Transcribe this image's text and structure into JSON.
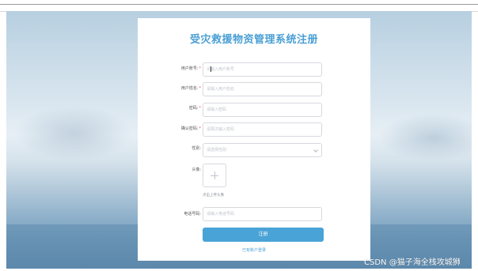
{
  "form": {
    "title": "受灾救援物资管理系统注册",
    "fields": [
      {
        "label": "用户账号:",
        "required": true,
        "placeholder": "请输入用户账号",
        "value": ""
      },
      {
        "label": "用户姓名:",
        "required": true,
        "placeholder": "请输入用户姓名",
        "value": ""
      },
      {
        "label": "密码:",
        "required": true,
        "placeholder": "请输入密码",
        "value": ""
      },
      {
        "label": "确认密码:",
        "required": true,
        "placeholder": "请再次输入密码",
        "value": ""
      },
      {
        "label": "性别:",
        "required": false,
        "placeholder": "请选择性别",
        "value": ""
      }
    ],
    "avatar": {
      "label": "头像:",
      "hint": "点击上传头像"
    },
    "phone": {
      "label": "电话号码:",
      "placeholder": "请输入电话号码"
    },
    "submit_label": "注册",
    "login_link": "已有账户登录",
    "required_mark": "*"
  },
  "watermark": "CSDN @猫子海全栈攻城狮",
  "colors": {
    "accent": "#4aa3d6",
    "title": "#4a9fd4",
    "required": "#e05050"
  },
  "icons": {
    "upload": "plus-icon",
    "select": "chevron-down-icon"
  }
}
